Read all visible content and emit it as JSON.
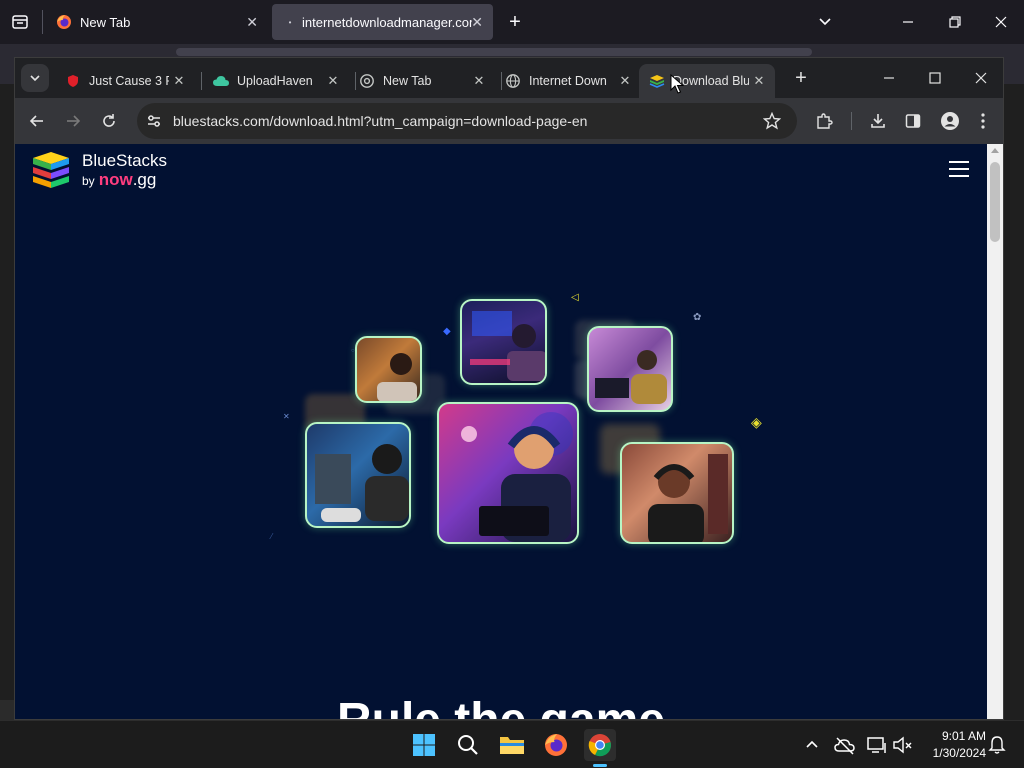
{
  "firefox": {
    "tabs": [
      {
        "label": "New Tab"
      },
      {
        "label": "internetdownloadmanager.com"
      }
    ]
  },
  "chrome": {
    "tabs": [
      {
        "label": "Just Cause 3 F"
      },
      {
        "label": "UploadHaven"
      },
      {
        "label": "New Tab"
      },
      {
        "label": "Internet Down"
      },
      {
        "label": "Download Blu"
      }
    ],
    "url": "bluestacks.com/download.html?utm_campaign=download-page-en"
  },
  "page": {
    "brand": {
      "name": "BlueStacks",
      "by": "by",
      "partner_now": "now",
      "partner_gg": ".gg"
    },
    "headline": "Rule the game"
  },
  "taskbar": {
    "time": "9:01 AM",
    "date": "1/30/2024"
  },
  "colors": {
    "page_bg": "#021132",
    "photo_border": "#b8f5c5",
    "now_gg_accent": "#ff3d7f"
  }
}
